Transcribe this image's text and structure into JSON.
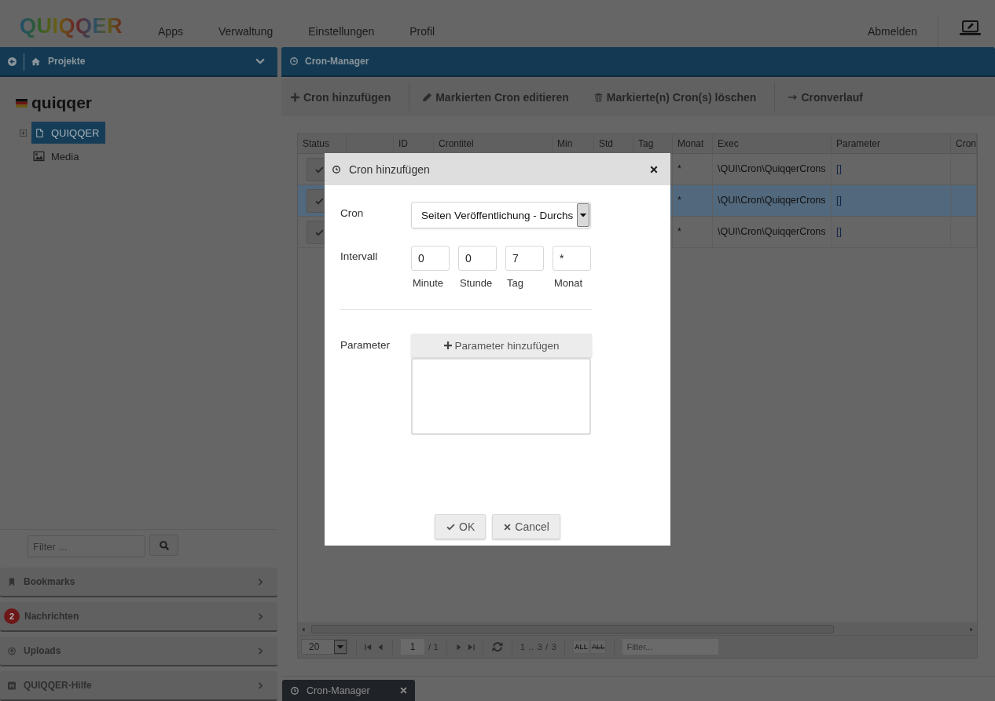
{
  "topbar": {
    "logo": "QUIQQER",
    "menu": [
      {
        "label": "Apps"
      },
      {
        "label": "Verwaltung"
      },
      {
        "label": "Einstellungen"
      },
      {
        "label": "Profil"
      }
    ],
    "logout": "Abmelden"
  },
  "sidebar": {
    "title": "Projekte",
    "project": {
      "title": "quiqqer",
      "items": [
        {
          "label": "QUIQQER",
          "kind": "page",
          "expanded": false,
          "selected": true
        },
        {
          "label": "Media",
          "kind": "media",
          "selected": false
        }
      ]
    },
    "filter": {
      "placeholder": "Filter ..."
    },
    "panels": [
      {
        "label": "Bookmarks",
        "kind": "bookmarks"
      },
      {
        "label": "Nachrichten",
        "kind": "messages",
        "badge": "2"
      },
      {
        "label": "Uploads",
        "kind": "uploads"
      },
      {
        "label": "QUIQQER-Hilfe",
        "kind": "help"
      }
    ]
  },
  "panel": {
    "title": "Cron-Manager",
    "toolbar": [
      {
        "buttons": [
          {
            "label": "Cron hinzufügen",
            "kind": "add"
          }
        ]
      },
      {
        "buttons": [
          {
            "label": "Markierten Cron editieren",
            "kind": "edit"
          },
          {
            "label": "Markierte(n) Cron(s) löschen",
            "kind": "delete"
          }
        ]
      },
      {
        "buttons": [
          {
            "label": "Cronverlauf",
            "kind": "history"
          }
        ]
      }
    ],
    "table": {
      "columns": [
        "Status",
        null,
        "ID",
        "Crontitel",
        "Min",
        "Std",
        "Tag",
        "Monat",
        "Exec",
        "Parameter",
        "Cron"
      ],
      "rows": [
        {
          "selected": false,
          "active": true,
          "month": "*",
          "exec": "\\QUI\\Cron\\QuiqqerCrons",
          "parameter": "[]"
        },
        {
          "selected": true,
          "active": true,
          "month": "*",
          "exec": "\\QUI\\Cron\\QuiqqerCrons",
          "parameter": "[]"
        },
        {
          "selected": false,
          "active": true,
          "month": "*",
          "exec": "\\QUI\\Cron\\QuiqqerCrons",
          "parameter": "[]"
        }
      ],
      "pager": {
        "per_page": "20",
        "page": "1",
        "pages": "/ 1",
        "range": "1 .. 3 / 3",
        "select_all": "ALL",
        "deselect_all": "ALL",
        "filter": {
          "placeholder": "Filter..."
        }
      }
    }
  },
  "taskbar": {
    "tabs": [
      {
        "label": "Cron-Manager",
        "selected": true
      }
    ]
  },
  "dialog": {
    "title": "Cron hinzufügen",
    "cron": {
      "label": "Cron",
      "value": "Seiten Veröffentlichung - Durchs"
    },
    "interval": {
      "label": "Intervall",
      "fields": [
        {
          "value": "0",
          "caption": "Minute"
        },
        {
          "value": "0",
          "caption": "Stunde"
        },
        {
          "value": "7",
          "caption": "Tag"
        },
        {
          "value": "*",
          "caption": "Monat"
        }
      ]
    },
    "parameter": {
      "label": "Parameter",
      "button": "Parameter hinzufügen"
    },
    "buttons": [
      {
        "label": "OK",
        "kind": "ok"
      },
      {
        "label": "Cancel",
        "kind": "cancel"
      }
    ]
  }
}
